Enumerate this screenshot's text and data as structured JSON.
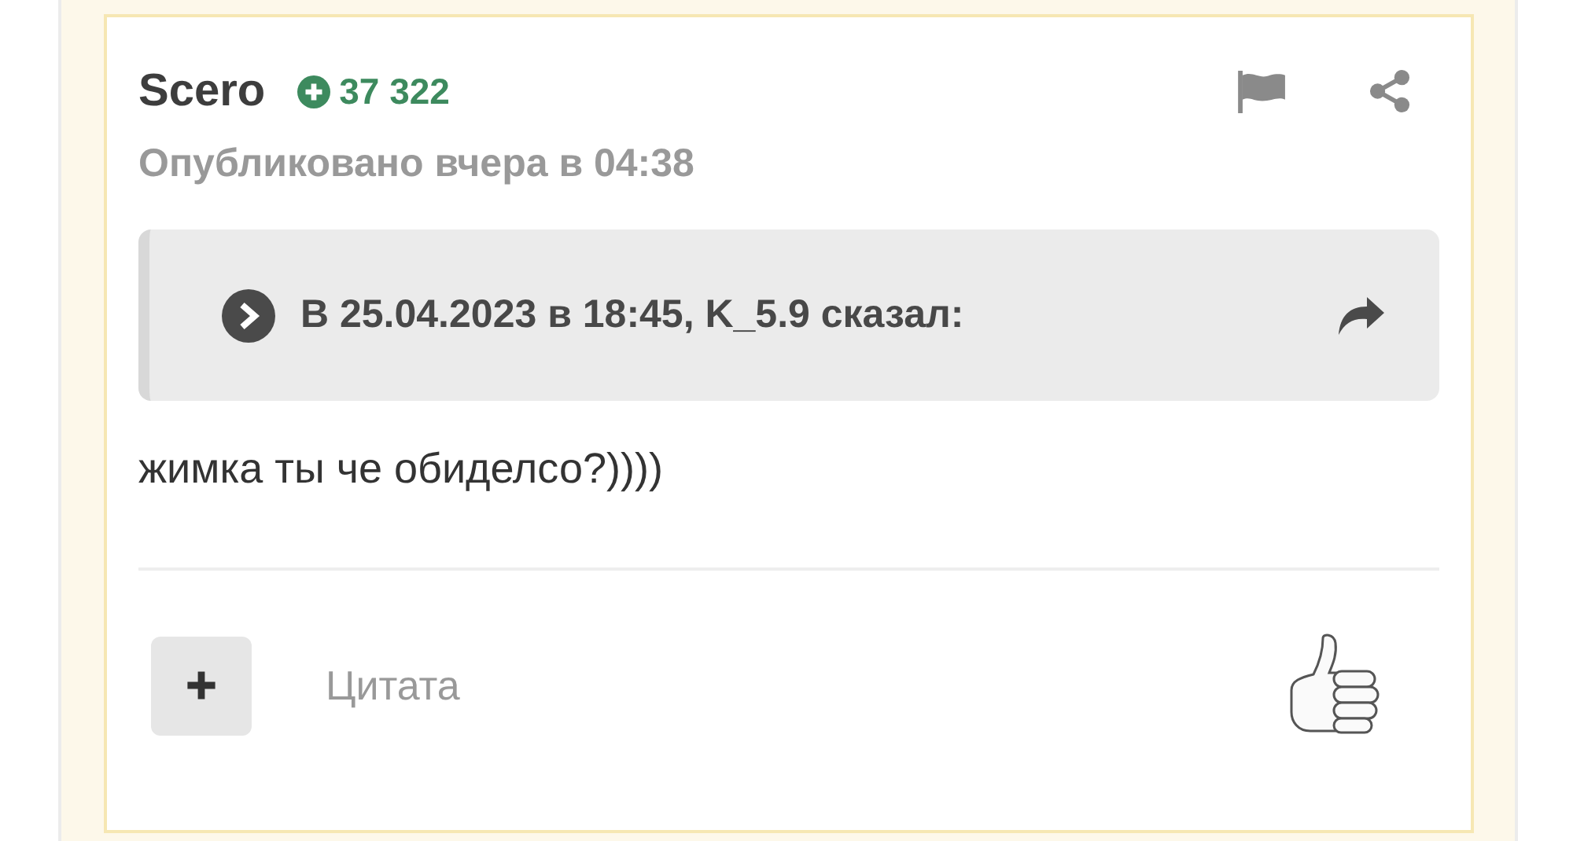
{
  "post": {
    "author": "Scero",
    "reputation": "37 322",
    "published": "Опубликовано вчера в 04:38",
    "quote": {
      "citation": "В 25.04.2023 в 18:45, K_5.9 сказал:"
    },
    "body": "жимка ты че обиделсо?))))",
    "footer": {
      "quote_label": "Цитата"
    }
  }
}
